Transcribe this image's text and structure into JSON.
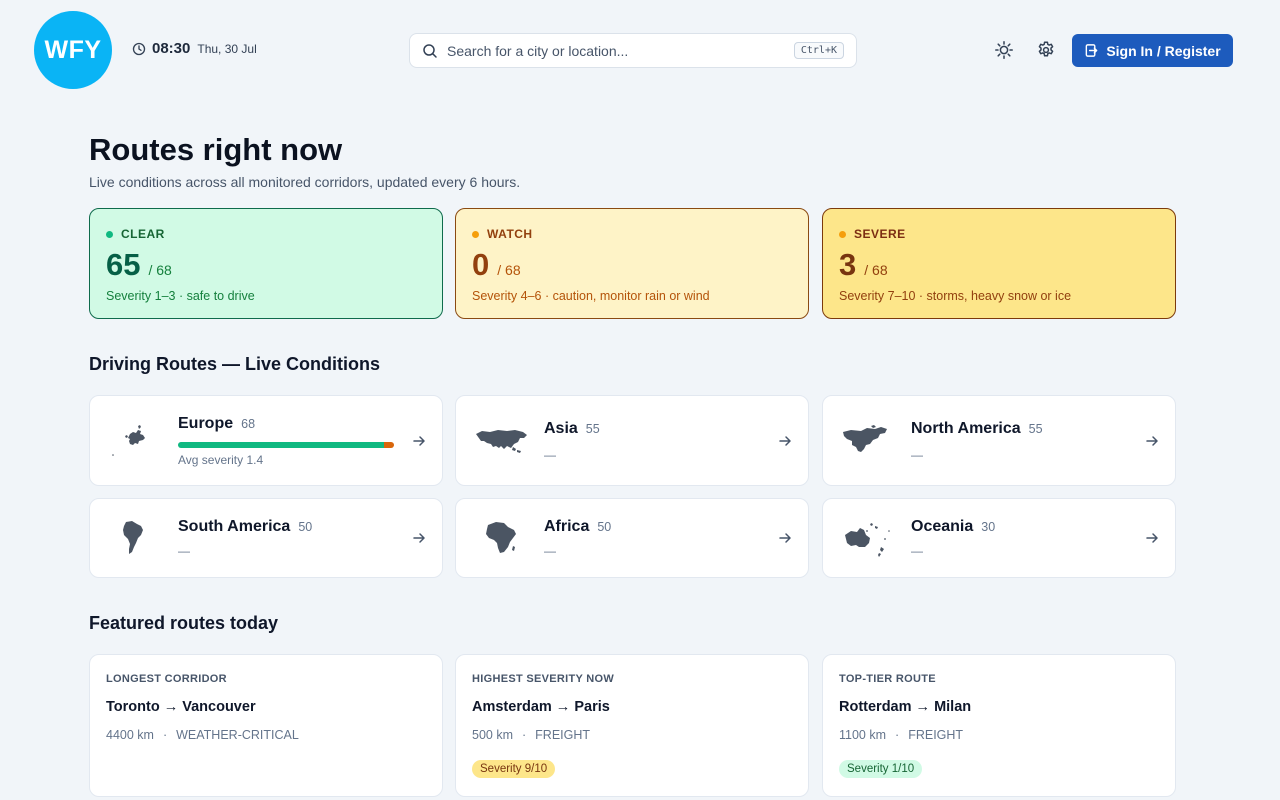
{
  "header": {
    "logo": "WFY",
    "time": "08:30",
    "date": "Thu, 30 Jul",
    "search_placeholder": "Search for a city or location...",
    "search_shortcut": "Ctrl+K",
    "signin_label": "Sign In / Register"
  },
  "hero": {
    "title": "Routes right now",
    "subtitle": "Live conditions across all monitored corridors, updated every 6 hours."
  },
  "stats": [
    {
      "label": "CLEAR",
      "value": "65",
      "total": "/ 68",
      "desc": "Severity 1–3 · safe to drive"
    },
    {
      "label": "WATCH",
      "value": "0",
      "total": "/ 68",
      "desc": "Severity 4–6 · caution, monitor rain or wind"
    },
    {
      "label": "SEVERE",
      "value": "3",
      "total": "/ 68",
      "desc": "Severity 7–10 · storms, heavy snow or ice"
    }
  ],
  "regions_title": "Driving Routes — Live Conditions",
  "regions": [
    {
      "name": "Europe",
      "count": "68",
      "sub": "Avg severity 1.4",
      "clear_fraction": 0.956,
      "severe_fraction": 0.044
    },
    {
      "name": "Asia",
      "count": "55",
      "sub": "—"
    },
    {
      "name": "North America",
      "count": "55",
      "sub": "—"
    },
    {
      "name": "South America",
      "count": "50",
      "sub": "—"
    },
    {
      "name": "Africa",
      "count": "50",
      "sub": "—"
    },
    {
      "name": "Oceania",
      "count": "30",
      "sub": "—"
    }
  ],
  "featured_title": "Featured routes today",
  "featured": [
    {
      "tag": "LONGEST CORRIDOR",
      "route": "Toronto → Vancouver",
      "distance": "4400 km",
      "sep": "·",
      "type": "WEATHER-CRITICAL",
      "badge": ""
    },
    {
      "tag": "HIGHEST SEVERITY NOW",
      "route": "Amsterdam → Paris",
      "distance": "500 km",
      "sep": "·",
      "type": "FREIGHT",
      "badge": "Severity 9/10"
    },
    {
      "tag": "TOP-TIER ROUTE",
      "route": "Rotterdam → Milan",
      "distance": "1100 km",
      "sep": "·",
      "type": "FREIGHT",
      "badge": "Severity 1/10"
    }
  ],
  "colors": {
    "brand": "#0ab4f5",
    "primary": "#1d5bbd",
    "clear": "#10b981",
    "watch": "#f59e0b",
    "severe": "#d9660b",
    "map": "#4b5563"
  },
  "icons": {
    "clock": "clock-icon",
    "search": "search-icon",
    "theme": "sun-icon",
    "settings": "gear-icon",
    "signin": "sign-in-icon",
    "arrow": "arrow-right-icon"
  }
}
